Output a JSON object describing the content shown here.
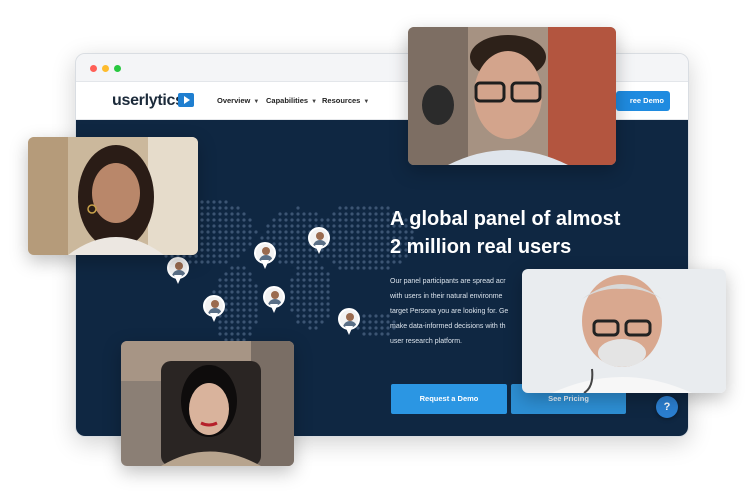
{
  "browser": {
    "logo": {
      "text": "userlytics"
    },
    "nav": {
      "items": [
        {
          "label": "Overview"
        },
        {
          "label": "Capabilities"
        },
        {
          "label": "Resources"
        }
      ],
      "demo_button": "ree Demo"
    }
  },
  "hero": {
    "title_line1": "A global panel of almost",
    "title_line2": "2 million real users",
    "body_lines": [
      "Our panel participants are spread acr",
      "with users in their natural environme",
      "target Persona you are looking for. Ge",
      "make data-informed decisions with th",
      "user research platform."
    ],
    "primary_button": "Request a Demo",
    "secondary_button": "See Pricing",
    "help_icon": "?"
  },
  "colors": {
    "hero_bg": "#0f2742",
    "accent": "#2b96e3",
    "map_dot": "#3c5573"
  },
  "icons": [
    "chevron-down-icon",
    "play-icon",
    "help-icon",
    "location-pin-icon"
  ]
}
